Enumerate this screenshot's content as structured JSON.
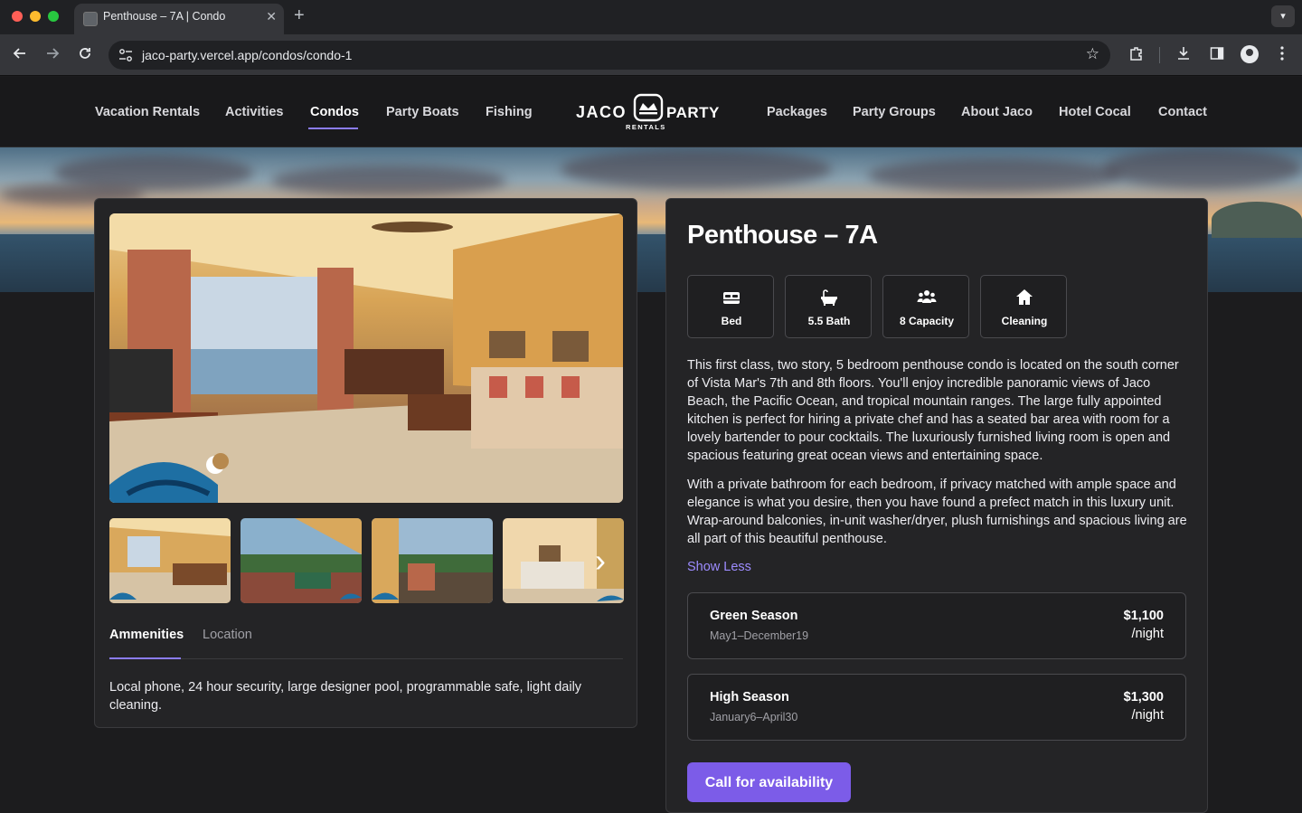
{
  "browser": {
    "tab_title": "Penthouse – 7A | Condo",
    "tab_close": "✕",
    "new_tab": "+",
    "url": "jaco-party.vercel.app/condos/condo-1",
    "icons": [
      "back-arrow-icon",
      "forward-arrow-icon",
      "reload-icon",
      "site-settings-icon",
      "bookmark-star-icon",
      "extensions-icon",
      "download-icon",
      "side-panel-icon",
      "profile-icon",
      "more-menu-icon"
    ]
  },
  "nav": {
    "left_links": [
      "Vacation Rentals",
      "Activities",
      "Condos",
      "Party Boats",
      "Fishing"
    ],
    "right_links": [
      "Packages",
      "Party Groups",
      "About Jaco",
      "Hotel Cocal",
      "Contact"
    ],
    "active": "Condos",
    "logo": {
      "word1": "JACO",
      "word2": "PARTY",
      "sub": "RENTALS"
    }
  },
  "gallery": {
    "thumbnail_count": 4,
    "next_arrow": "›"
  },
  "tabs": {
    "amenities": "Ammenities",
    "location": "Location",
    "active": "Ammenities"
  },
  "amenities_text": "Local phone, 24 hour security, large designer pool, programmable safe, light daily cleaning.",
  "listing": {
    "title": "Penthouse – 7A",
    "features": [
      {
        "label": "Bed",
        "icon": "bed-icon"
      },
      {
        "label": "5.5 Bath",
        "icon": "bathtub-icon"
      },
      {
        "label": "8 Capacity",
        "icon": "people-group-icon"
      },
      {
        "label": "Cleaning",
        "icon": "house-icon"
      }
    ],
    "description_1": "This first class, two story, 5 bedroom penthouse condo is located on the south corner of Vista Mar's 7th and 8th floors. You'll enjoy incredible panoramic views of Jaco Beach, the Pacific Ocean, and tropical mountain ranges. The large fully appointed kitchen is perfect for hiring a private chef and has a seated bar area with room for a lovely bartender to pour cocktails. The luxuriously furnished living room is open and spacious featuring great ocean views and entertaining space.",
    "description_2": "With a private bathroom for each bedroom, if privacy matched with ample space and elegance is what you desire, then you have found a prefect match in this luxury unit. Wrap-around balconies, in-unit washer/dryer, plush furnishings and spacious living are all part of this beautiful penthouse.",
    "show_less": "Show Less",
    "seasons": [
      {
        "name": "Green Season",
        "dates": "May1–December19",
        "price": "$1,100",
        "unit": "/night"
      },
      {
        "name": "High Season",
        "dates": "January6–April30",
        "price": "$1,300",
        "unit": "/night"
      }
    ],
    "cta": "Call for availability"
  },
  "colors": {
    "accent": "#8b7cf6",
    "cta": "#7c5ce8",
    "link": "#9d8cff",
    "page_bg": "#1c1c1e",
    "card_bg": "#242426"
  }
}
